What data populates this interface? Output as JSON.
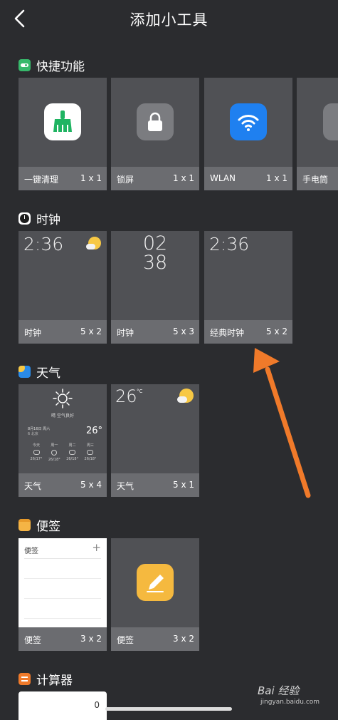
{
  "header": {
    "title": "添加小工具"
  },
  "sections": {
    "shortcuts": {
      "label": "快捷功能",
      "cards": [
        {
          "name": "一键清理",
          "size": "1 x 1"
        },
        {
          "name": "锁屏",
          "size": "1 x 1"
        },
        {
          "name": "WLAN",
          "size": "1 x 1"
        },
        {
          "name": "手电筒",
          "size": ""
        }
      ]
    },
    "clock": {
      "label": "时钟",
      "cards": [
        {
          "name": "时钟",
          "size": "5 x 2",
          "time": "2:36"
        },
        {
          "name": "时钟",
          "size": "5 x 3",
          "hour": "02",
          "minute": "38"
        },
        {
          "name": "经典时钟",
          "size": "5 x 2",
          "time": "2:36"
        }
      ]
    },
    "weather": {
      "label": "天气",
      "cards": [
        {
          "name": "天气",
          "size": "5 x 4",
          "condition": "晴 空气良好",
          "date": "8月16日 周六",
          "place": "6 北京",
          "temp": "26°",
          "days": [
            "今天",
            "周一",
            "周二",
            "周三"
          ],
          "ranges": [
            "26/17°",
            "26/18°",
            "26/18°",
            "26/18°"
          ]
        },
        {
          "name": "天气",
          "size": "5 x 1",
          "temp": "26",
          "unit": "°C"
        }
      ]
    },
    "notes": {
      "label": "便签",
      "cards": [
        {
          "name": "便签",
          "size": "3 x 2",
          "header": "便签",
          "plus": "+"
        },
        {
          "name": "便签",
          "size": "3 x 2"
        }
      ]
    },
    "calculator": {
      "label": "计算器",
      "display": "0"
    }
  },
  "watermark": {
    "brand": "Bai 经验",
    "url": "jingyan.baidu.com"
  },
  "colors": {
    "background": "#2b2c2f",
    "card": "#505155",
    "card_footer": "#6b6c70",
    "arrow": "#f07a2a"
  }
}
